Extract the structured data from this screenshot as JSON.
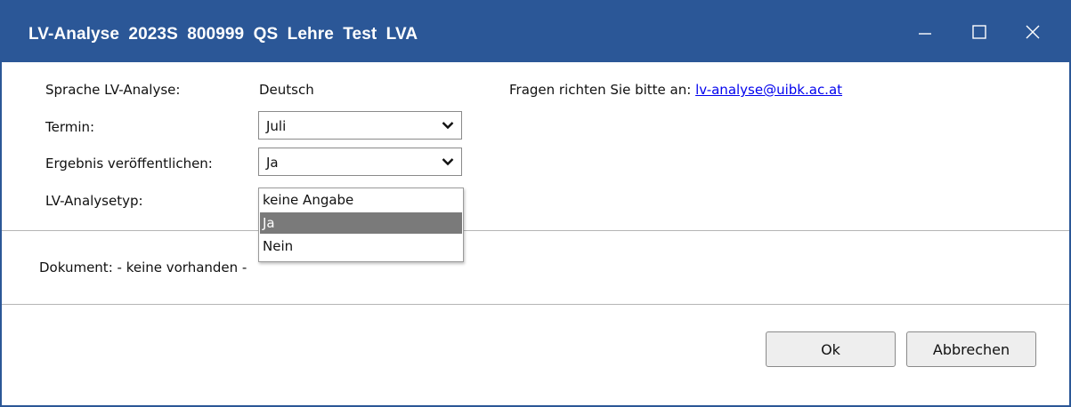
{
  "window": {
    "title": "LV-Analyse  2023S  800999  QS Lehre Test LVA",
    "controls": {
      "minimize": "minimize-icon",
      "maximize": "maximize-icon",
      "close": "close-icon"
    }
  },
  "form": {
    "sprache_label": "Sprache  LV-Analyse:",
    "sprache_value": "Deutsch",
    "termin_label": "Termin:",
    "termin_value": "Juli",
    "ergebnis_label": "Ergebnis veröffentlichen:",
    "ergebnis_value": "Ja",
    "typ_label": "LV-Analysetyp:"
  },
  "contact": {
    "text": "Fragen richten Sie bitte an:",
    "email": "lv-analyse@uibk.ac.at"
  },
  "dropdown": {
    "options": [
      "keine Angabe",
      "Ja",
      "Nein"
    ],
    "selected": "Ja"
  },
  "document": {
    "label": "Dokument: - keine vorhanden -"
  },
  "buttons": {
    "ok": "Ok",
    "cancel": "Abbrechen"
  },
  "colors": {
    "titlebar": "#2b5797",
    "selected_option": "#7a7a7a",
    "link": "#0000ee"
  }
}
